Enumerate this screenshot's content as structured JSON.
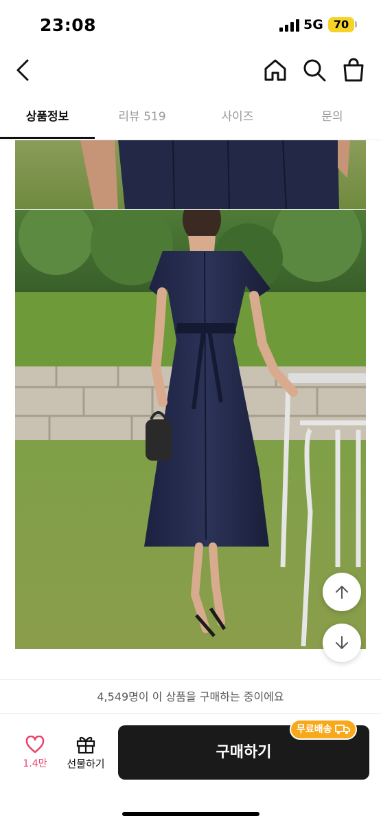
{
  "status_bar": {
    "time": "23:08",
    "network": "5G",
    "battery": "70"
  },
  "header": {
    "back_icon": "chevron-left-icon",
    "home_icon": "home-icon",
    "search_icon": "search-icon",
    "cart_icon": "shopping-bag-icon"
  },
  "tabs": [
    {
      "label": "상품정보",
      "active": true
    },
    {
      "label": "리뷰 519",
      "active": false
    },
    {
      "label": "사이즈",
      "active": false
    },
    {
      "label": "문의",
      "active": false
    }
  ],
  "images": [
    {
      "description_icon": "product-photo-top"
    },
    {
      "description_icon": "product-photo-main"
    }
  ],
  "scroll": {
    "up_icon": "arrow-up-icon",
    "down_icon": "arrow-down-icon"
  },
  "purchase_notice": "4,549명이 이 상품을 구매하는 중이에요",
  "bottom_bar": {
    "like_count": "1.4만",
    "gift_label": "선물하기",
    "buy_label": "구매하기",
    "free_shipping_label": "무료배송"
  },
  "colors": {
    "accent_like": "#e8436a",
    "buy_button": "#1a1a1a",
    "free_ship_badge": "#f7a81b",
    "battery": "#f5d327"
  }
}
